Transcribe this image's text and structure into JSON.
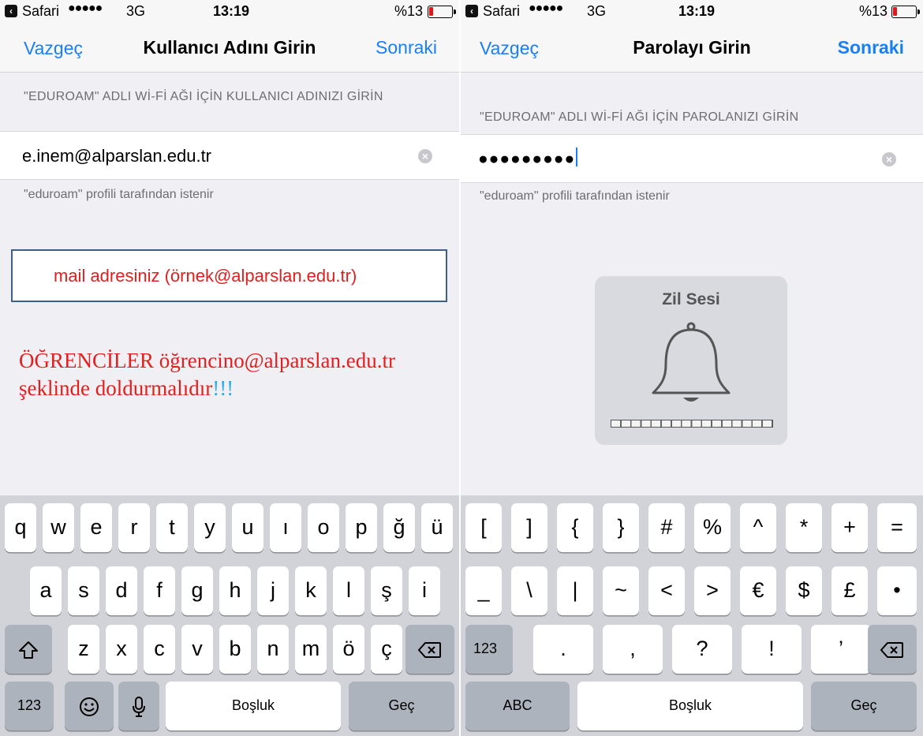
{
  "left": {
    "status": {
      "app": "Safari",
      "signal": "●●●●●",
      "network": "3G",
      "time": "13:19",
      "battery": "%13"
    },
    "nav": {
      "left": "Vazgeç",
      "title": "Kullanıcı Adını Girin",
      "right": "Sonraki"
    },
    "section_header": "\"EDUROAM\" ADLI Wİ-Fİ AĞI İÇİN KULLANICI ADINIZI GİRİN",
    "field_value": "e.inem@alparslan.edu.tr",
    "footer": "\"eduroam\" profili tarafından istenir",
    "annotation_box": "mail adresiniz (örnek@alparslan.edu.tr)",
    "annotation_text": "ÖĞRENCİLER öğrencino@alparslan.edu.tr şeklinde doldurmalıdır",
    "annotation_exclaim": "!!!",
    "keyboard": {
      "row1": [
        "q",
        "w",
        "e",
        "r",
        "t",
        "y",
        "u",
        "ı",
        "o",
        "p",
        "ğ",
        "ü"
      ],
      "row2": [
        "a",
        "s",
        "d",
        "f",
        "g",
        "h",
        "j",
        "k",
        "l",
        "ş",
        "i"
      ],
      "row3": [
        "z",
        "x",
        "c",
        "v",
        "b",
        "n",
        "m",
        "ö",
        "ç"
      ],
      "numbers": "123",
      "space": "Boşluk",
      "go": "Geç"
    }
  },
  "right": {
    "status": {
      "app": "Safari",
      "signal": "●●●●●",
      "network": "3G",
      "time": "13:19",
      "battery": "%13"
    },
    "nav": {
      "left": "Vazgeç",
      "title": "Parolayı Girin",
      "right": "Sonraki"
    },
    "section_header": "\"EDUROAM\" ADLI Wİ-Fİ AĞI İÇİN PAROLANIZI GİRİN",
    "field_value": "●●●●●●●●●",
    "footer": "\"eduroam\" profili tarafından istenir",
    "hud_title": "Zil Sesi",
    "keyboard": {
      "row1": [
        "[",
        "]",
        "{",
        "}",
        "#",
        "%",
        "^",
        "*",
        "+",
        "="
      ],
      "row2": [
        "_",
        "\\",
        "|",
        "~",
        "<",
        ">",
        "€",
        "$",
        "£",
        "•"
      ],
      "row3": [
        ".",
        ",",
        "?",
        "!",
        "’"
      ],
      "numbers": "123",
      "abc": "ABC",
      "space": "Boşluk",
      "go": "Geç"
    }
  },
  "colors": {
    "accent": "#1a7ff5",
    "annotation_red": "#e21e1e",
    "annotation_blue": "#26aee8"
  }
}
